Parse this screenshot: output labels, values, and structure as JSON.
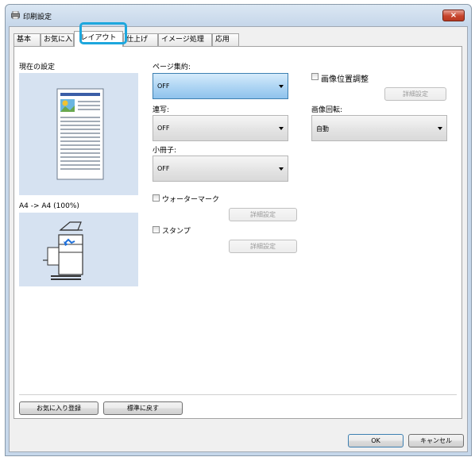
{
  "window": {
    "title": "印刷設定",
    "close_label": "×"
  },
  "tabs": [
    {
      "label": "基本"
    },
    {
      "label": "お気に入り"
    },
    {
      "label": "レイアウト"
    },
    {
      "label": "仕上げ"
    },
    {
      "label": "イメージ処理"
    },
    {
      "label": "応用"
    }
  ],
  "layout": {
    "current_settings_label": "現在の設定",
    "paper_size_text": "A4 -> A4 (100%)",
    "page_aggregation": {
      "label": "ページ集約:",
      "value": "OFF"
    },
    "repeat": {
      "label": "連写:",
      "value": "OFF"
    },
    "booklet": {
      "label": "小冊子:",
      "value": "OFF"
    },
    "watermark": {
      "label": "ウォーターマーク",
      "button": "詳細設定"
    },
    "stamp": {
      "label": "スタンプ",
      "button": "詳細設定"
    },
    "image_position": {
      "label": "画像位置調整",
      "button": "詳細設定"
    },
    "image_rotation": {
      "label": "画像回転:",
      "value": "自動"
    }
  },
  "footer": {
    "save_favorite": "お気に入り登録",
    "reset_default": "標準に戻す"
  },
  "dialog": {
    "ok": "OK",
    "cancel": "キャンセル"
  },
  "colors": {
    "accent_highlight": "#1da7dd",
    "preview_bg": "#d6e2f1",
    "close_red": "#c7442c"
  }
}
